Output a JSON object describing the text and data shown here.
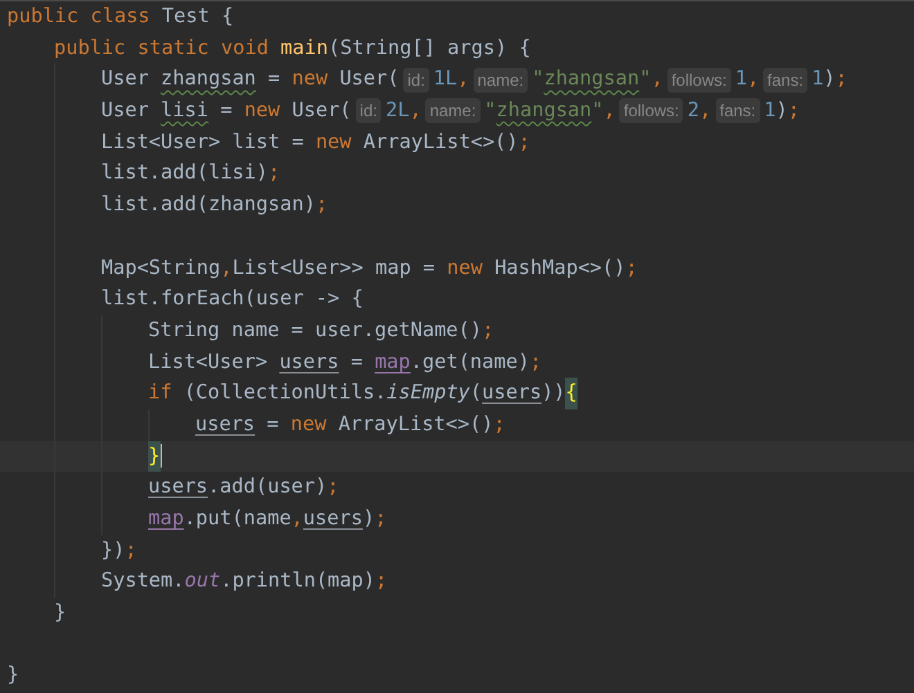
{
  "editor": {
    "lines": [
      {
        "kind": "code",
        "tokens": [
          {
            "text": "public class ",
            "kind": "kw"
          },
          {
            "text": "Test {",
            "kind": "plain"
          }
        ],
        "children": [
          {
            "kind": "code",
            "tokens": [
              {
                "text": "public static void ",
                "kind": "kw"
              },
              {
                "text": "main",
                "kind": "fn"
              },
              {
                "text": "(String[] args) {",
                "kind": "plain"
              }
            ],
            "children": [
              {
                "kind": "code",
                "tokens": [
                  {
                    "text": "User ",
                    "kind": "plain"
                  },
                  {
                    "text": "zhangsan",
                    "kind": "plain-typo"
                  },
                  {
                    "text": " = ",
                    "kind": "plain"
                  },
                  {
                    "text": "new ",
                    "kind": "kw"
                  },
                  {
                    "text": "User(",
                    "kind": "plain"
                  },
                  {
                    "text": "id:",
                    "kind": "hint"
                  },
                  {
                    "text": "1L",
                    "kind": "num"
                  },
                  {
                    "text": ",",
                    "kind": "semi"
                  },
                  {
                    "text": "name:",
                    "kind": "hint"
                  },
                  {
                    "text": "\"",
                    "kind": "str"
                  },
                  {
                    "text": "zhangsan",
                    "kind": "str-typo"
                  },
                  {
                    "text": "\"",
                    "kind": "str"
                  },
                  {
                    "text": ",",
                    "kind": "semi"
                  },
                  {
                    "text": "follows:",
                    "kind": "hint"
                  },
                  {
                    "text": "1",
                    "kind": "num"
                  },
                  {
                    "text": ",",
                    "kind": "semi"
                  },
                  {
                    "text": "fans:",
                    "kind": "hint"
                  },
                  {
                    "text": "1",
                    "kind": "num"
                  },
                  {
                    "text": ")",
                    "kind": "plain"
                  },
                  {
                    "text": ";",
                    "kind": "semi"
                  }
                ]
              },
              {
                "kind": "code",
                "tokens": [
                  {
                    "text": "User ",
                    "kind": "plain"
                  },
                  {
                    "text": "lisi",
                    "kind": "plain-typo"
                  },
                  {
                    "text": " = ",
                    "kind": "plain"
                  },
                  {
                    "text": "new ",
                    "kind": "kw"
                  },
                  {
                    "text": "User(",
                    "kind": "plain"
                  },
                  {
                    "text": "id:",
                    "kind": "hint"
                  },
                  {
                    "text": "2L",
                    "kind": "num"
                  },
                  {
                    "text": ",",
                    "kind": "semi"
                  },
                  {
                    "text": "name:",
                    "kind": "hint"
                  },
                  {
                    "text": "\"",
                    "kind": "str"
                  },
                  {
                    "text": "zhangsan",
                    "kind": "str-typo"
                  },
                  {
                    "text": "\"",
                    "kind": "str"
                  },
                  {
                    "text": ",",
                    "kind": "semi"
                  },
                  {
                    "text": "follows:",
                    "kind": "hint"
                  },
                  {
                    "text": "2",
                    "kind": "num"
                  },
                  {
                    "text": ",",
                    "kind": "semi"
                  },
                  {
                    "text": "fans:",
                    "kind": "hint"
                  },
                  {
                    "text": "1",
                    "kind": "num"
                  },
                  {
                    "text": ")",
                    "kind": "plain"
                  },
                  {
                    "text": ";",
                    "kind": "semi"
                  }
                ]
              },
              {
                "kind": "code",
                "tokens": [
                  {
                    "text": "List<User> list = ",
                    "kind": "plain"
                  },
                  {
                    "text": "new ",
                    "kind": "kw"
                  },
                  {
                    "text": "ArrayList<>()",
                    "kind": "plain"
                  },
                  {
                    "text": ";",
                    "kind": "semi"
                  }
                ]
              },
              {
                "kind": "code",
                "tokens": [
                  {
                    "text": "list.add(lisi)",
                    "kind": "plain"
                  },
                  {
                    "text": ";",
                    "kind": "semi"
                  }
                ]
              },
              {
                "kind": "code",
                "tokens": [
                  {
                    "text": "list.add(zhangsan)",
                    "kind": "plain"
                  },
                  {
                    "text": ";",
                    "kind": "semi"
                  }
                ]
              },
              {
                "kind": "blank"
              },
              {
                "kind": "code",
                "tokens": [
                  {
                    "text": "Map<String",
                    "kind": "plain"
                  },
                  {
                    "text": ",",
                    "kind": "semi"
                  },
                  {
                    "text": "List<User>> map = ",
                    "kind": "plain"
                  },
                  {
                    "text": "new ",
                    "kind": "kw"
                  },
                  {
                    "text": "HashMap<>()",
                    "kind": "plain"
                  },
                  {
                    "text": ";",
                    "kind": "semi"
                  }
                ]
              },
              {
                "kind": "code",
                "tokens": [
                  {
                    "text": "list.forEach(user -> {",
                    "kind": "plain"
                  }
                ],
                "children": [
                  {
                    "kind": "code",
                    "tokens": [
                      {
                        "text": "String name = user.getName()",
                        "kind": "plain"
                      },
                      {
                        "text": ";",
                        "kind": "semi"
                      }
                    ]
                  },
                  {
                    "kind": "code",
                    "tokens": [
                      {
                        "text": "List<User> ",
                        "kind": "plain"
                      },
                      {
                        "text": "users",
                        "kind": "plain-reassigned"
                      },
                      {
                        "text": " = ",
                        "kind": "plain"
                      },
                      {
                        "text": "map",
                        "kind": "field-reassigned"
                      },
                      {
                        "text": ".get(name)",
                        "kind": "plain"
                      },
                      {
                        "text": ";",
                        "kind": "semi"
                      }
                    ]
                  },
                  {
                    "kind": "code",
                    "tokens": [
                      {
                        "text": "if ",
                        "kind": "kw"
                      },
                      {
                        "text": "(CollectionUtils.",
                        "kind": "plain"
                      },
                      {
                        "text": "isEmpty",
                        "kind": "static"
                      },
                      {
                        "text": "(",
                        "kind": "plain"
                      },
                      {
                        "text": "users",
                        "kind": "plain-reassigned"
                      },
                      {
                        "text": "))",
                        "kind": "plain"
                      },
                      {
                        "text": "{",
                        "kind": "brace-match"
                      }
                    ],
                    "children": [
                      {
                        "kind": "code",
                        "tokens": [
                          {
                            "text": "users",
                            "kind": "plain-reassigned"
                          },
                          {
                            "text": " = ",
                            "kind": "plain"
                          },
                          {
                            "text": "new ",
                            "kind": "kw"
                          },
                          {
                            "text": "ArrayList<>()",
                            "kind": "plain"
                          },
                          {
                            "text": ";",
                            "kind": "semi"
                          }
                        ]
                      }
                    ]
                  },
                  {
                    "kind": "current",
                    "tokens": [
                      {
                        "text": "}",
                        "kind": "brace-match"
                      }
                    ]
                  },
                  {
                    "kind": "code",
                    "tokens": [
                      {
                        "text": "users",
                        "kind": "plain-reassigned"
                      },
                      {
                        "text": ".add(user)",
                        "kind": "plain"
                      },
                      {
                        "text": ";",
                        "kind": "semi"
                      }
                    ]
                  },
                  {
                    "kind": "code",
                    "tokens": [
                      {
                        "text": "map",
                        "kind": "field-reassigned"
                      },
                      {
                        "text": ".put(name",
                        "kind": "plain"
                      },
                      {
                        "text": ",",
                        "kind": "semi"
                      },
                      {
                        "text": "users",
                        "kind": "plain-reassigned"
                      },
                      {
                        "text": ")",
                        "kind": "plain"
                      },
                      {
                        "text": ";",
                        "kind": "semi"
                      }
                    ]
                  }
                ]
              },
              {
                "kind": "code",
                "tokens": [
                  {
                    "text": "})",
                    "kind": "plain"
                  },
                  {
                    "text": ";",
                    "kind": "semi"
                  }
                ]
              },
              {
                "kind": "code",
                "tokens": [
                  {
                    "text": "System.",
                    "kind": "plain"
                  },
                  {
                    "text": "out",
                    "kind": "static-field"
                  },
                  {
                    "text": ".println(map)",
                    "kind": "plain"
                  },
                  {
                    "text": ";",
                    "kind": "semi"
                  }
                ]
              }
            ]
          },
          {
            "kind": "code",
            "tokens": [
              {
                "text": "}",
                "kind": "plain"
              }
            ]
          }
        ]
      },
      {
        "kind": "blank"
      },
      {
        "kind": "code",
        "tokens": [
          {
            "text": "}",
            "kind": "plain"
          }
        ]
      }
    ]
  }
}
